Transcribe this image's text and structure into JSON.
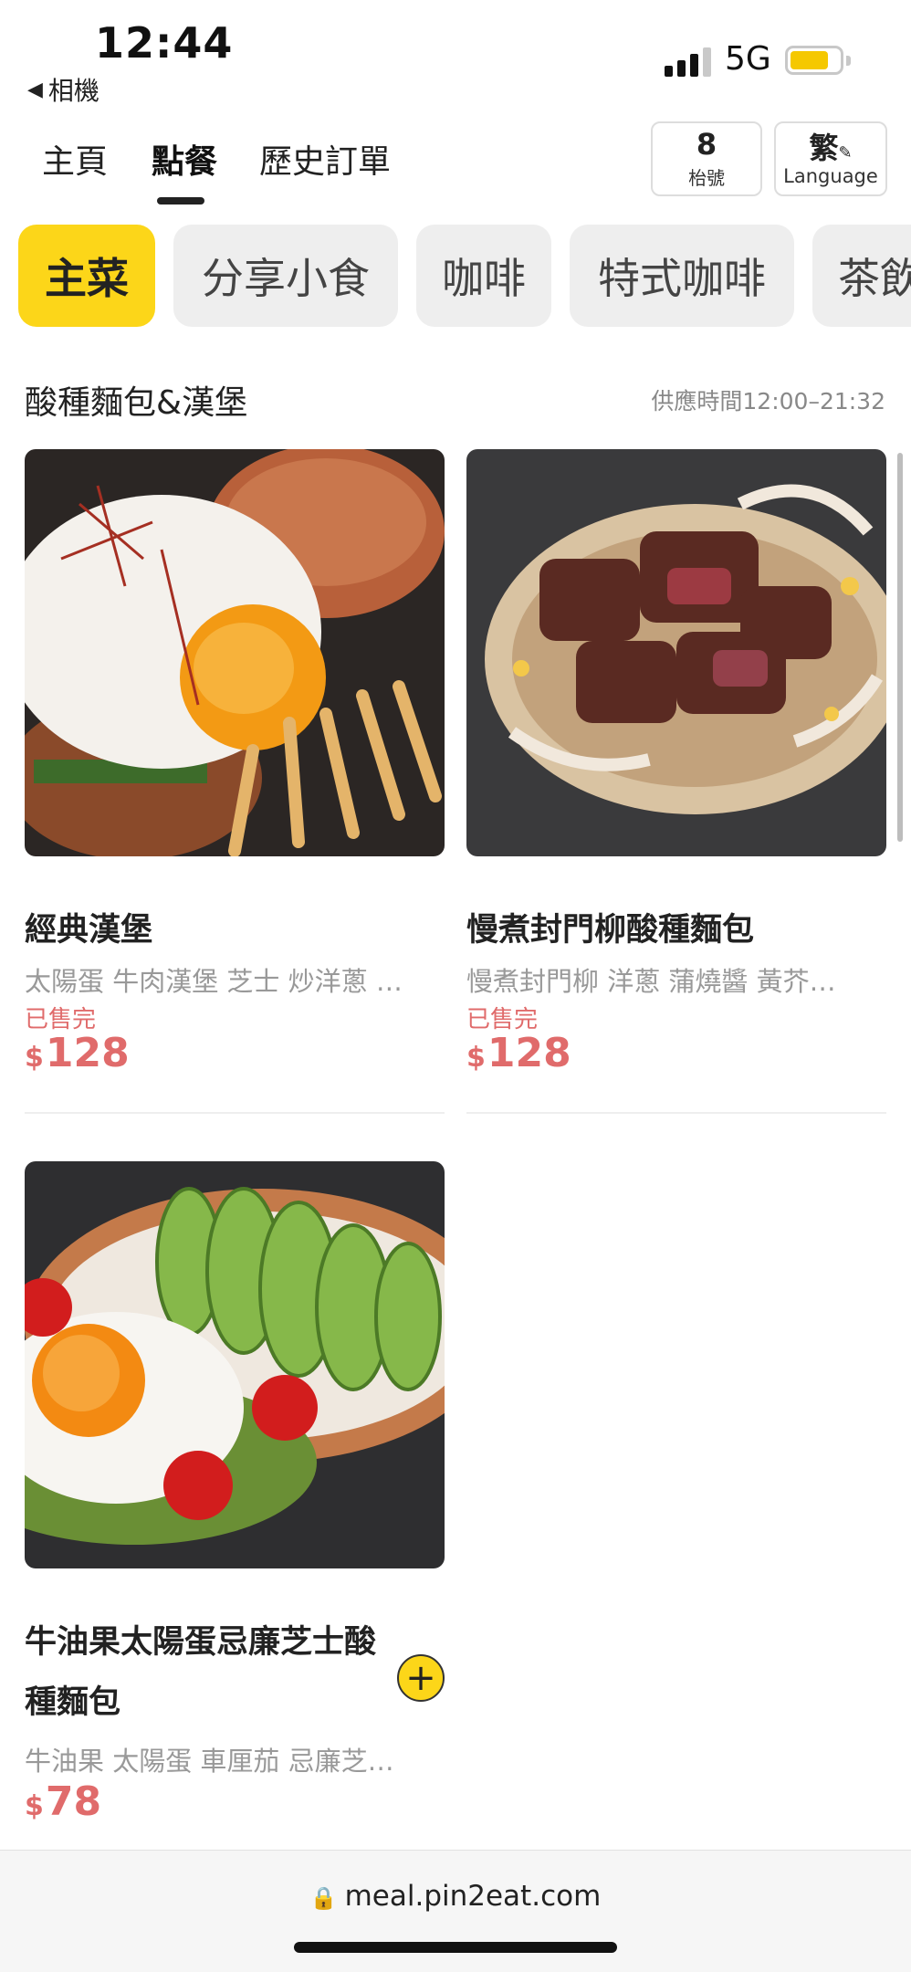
{
  "status_bar": {
    "time": "12:44",
    "back_label": "相機",
    "network": "5G",
    "battery_level": 0.78
  },
  "top_nav": {
    "tabs": [
      {
        "label": "主頁",
        "active": false
      },
      {
        "label": "點餐",
        "active": true
      },
      {
        "label": "歷史訂單",
        "active": false
      }
    ],
    "table": {
      "number": "8",
      "label": "枱號"
    },
    "language": {
      "short": "繁",
      "label": "Language"
    }
  },
  "categories": [
    {
      "label": "主菜",
      "active": true
    },
    {
      "label": "分享小食",
      "active": false
    },
    {
      "label": "咖啡",
      "active": false
    },
    {
      "label": "特式咖啡",
      "active": false
    },
    {
      "label": "茶飲",
      "active": false
    }
  ],
  "section": {
    "title": "酸種麵包&漢堡",
    "hours": "供應時間12:00–21:32"
  },
  "products": [
    {
      "name": "經典漢堡",
      "description": "太陽蛋 牛肉漢堡 芝士 炒洋蔥 …",
      "status": "已售完",
      "currency": "$",
      "price": "128"
    },
    {
      "name": "慢煮封門柳酸種麵包",
      "description": "慢煮封門柳 洋蔥 蒲燒醬 黃芥…",
      "status": "已售完",
      "currency": "$",
      "price": "128"
    },
    {
      "name": "牛油果太陽蛋忌廉芝士酸種麵包",
      "description": "牛油果 太陽蛋 車厘茄 忌廉芝…",
      "currency": "$",
      "price": "78"
    }
  ],
  "footer": {
    "url": "meal.pin2eat.com"
  },
  "colors": {
    "accent": "#fcd619",
    "price": "#e06b6b",
    "chip_bg": "#eeeeee"
  }
}
